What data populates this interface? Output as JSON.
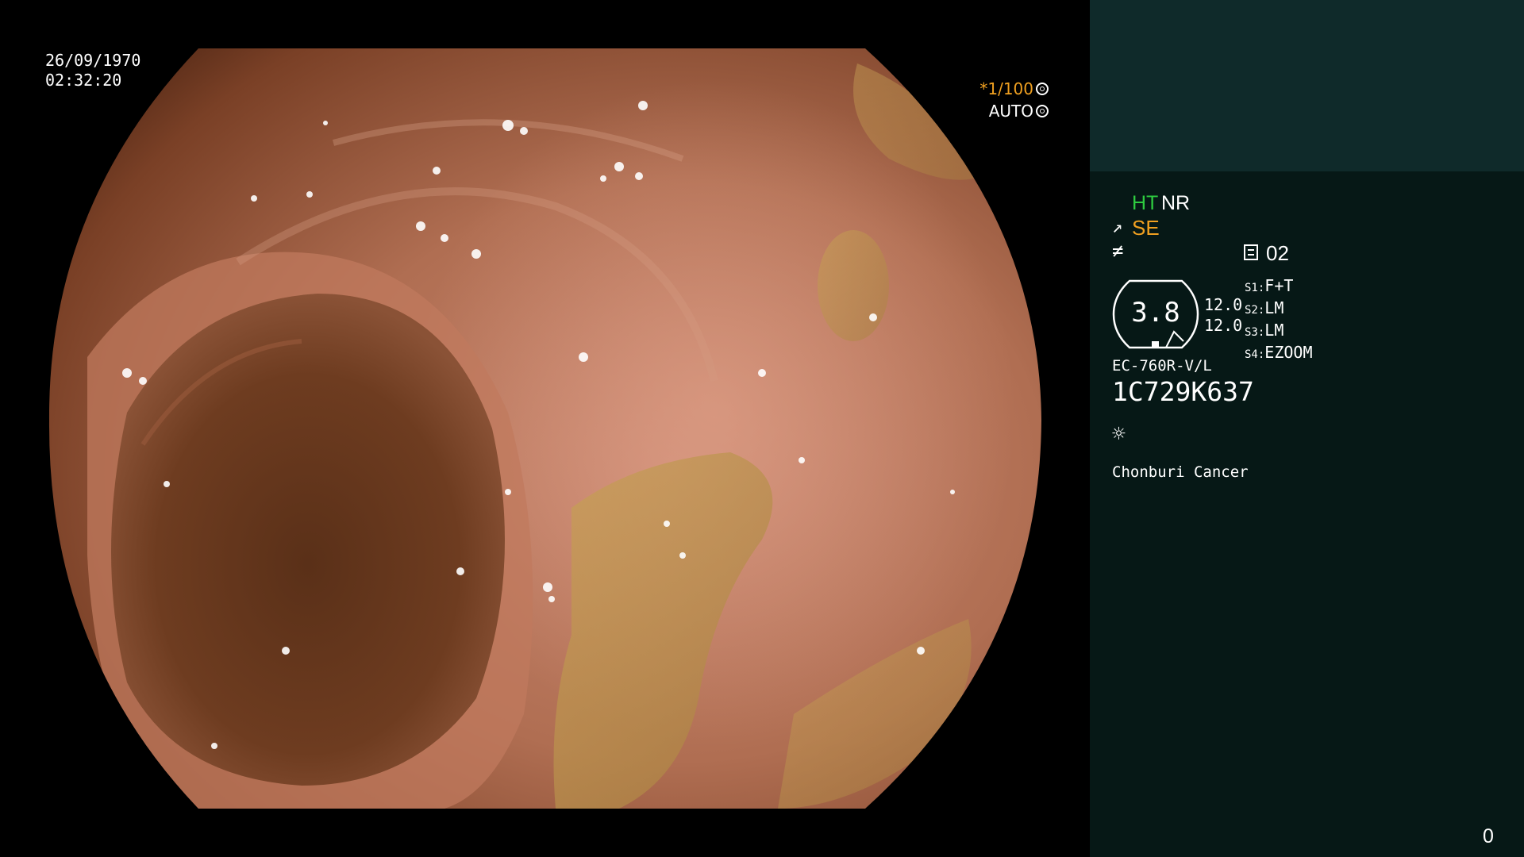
{
  "overlay": {
    "date": "26/09/1970",
    "time": "02:32:20",
    "shutter_speed": "*1/100",
    "shutter_mode": "AUTO"
  },
  "panel": {
    "ht_label": "HT",
    "nr_label": "NR",
    "se_label": "SE",
    "memo_value": "02",
    "zoom_value": "3.8",
    "zoom_right_1": "12.0",
    "zoom_right_2": "12.0",
    "switches": [
      {
        "key": "S1:",
        "value": "F+T"
      },
      {
        "key": "S2:",
        "value": "LM"
      },
      {
        "key": "S3:",
        "value": "LM"
      },
      {
        "key": "S4:",
        "value": "EZOOM"
      }
    ],
    "scope_model": "EC-760R-V/L",
    "serial": "1C729K637",
    "hospital": "Chonburi Cancer",
    "counter": "0"
  },
  "colors": {
    "panel_bg": "#061816",
    "panel_top_bg": "#0f2a2a",
    "accent_green": "#2ecc40",
    "accent_orange": "#f0a020"
  },
  "icons": {
    "shutter_icon": "aperture-icon",
    "mode_icon": "auto-exposure-icon",
    "se_icon": "structure-enhance-icon",
    "slash_icon": "color-mode-icon",
    "memo_icon": "memo-icon",
    "light_icon": "light-icon"
  }
}
